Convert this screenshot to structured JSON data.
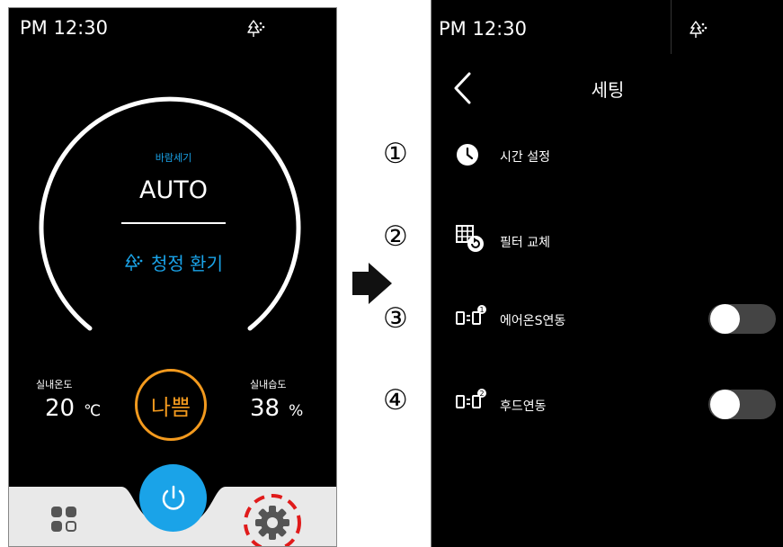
{
  "left_screen": {
    "status_time": "PM 12:30",
    "wind_label": "바람세기",
    "wind_mode": "AUTO",
    "vent_mode": "청정 환기",
    "temperature": {
      "label": "실내온도",
      "value": "20",
      "unit": "℃"
    },
    "humidity": {
      "label": "실내습도",
      "value": "38",
      "unit": "%"
    },
    "air_quality": "나쁨"
  },
  "annotations": [
    "①",
    "②",
    "③",
    "④"
  ],
  "right_screen": {
    "status_time": "PM 12:30",
    "title": "세팅",
    "items": [
      {
        "label": "시간 설정",
        "icon": "clock-icon"
      },
      {
        "label": "필터 교체",
        "icon": "filter-replace-icon"
      },
      {
        "label": "에어온S연동",
        "icon": "device-link-1-icon",
        "toggle": false
      },
      {
        "label": "후드연동",
        "icon": "device-link-2-icon",
        "toggle": false
      }
    ]
  },
  "colors": {
    "accent_blue": "#1aa3e8",
    "air_bad_orange": "#f39a1e",
    "highlight_red": "#e01b1b"
  }
}
